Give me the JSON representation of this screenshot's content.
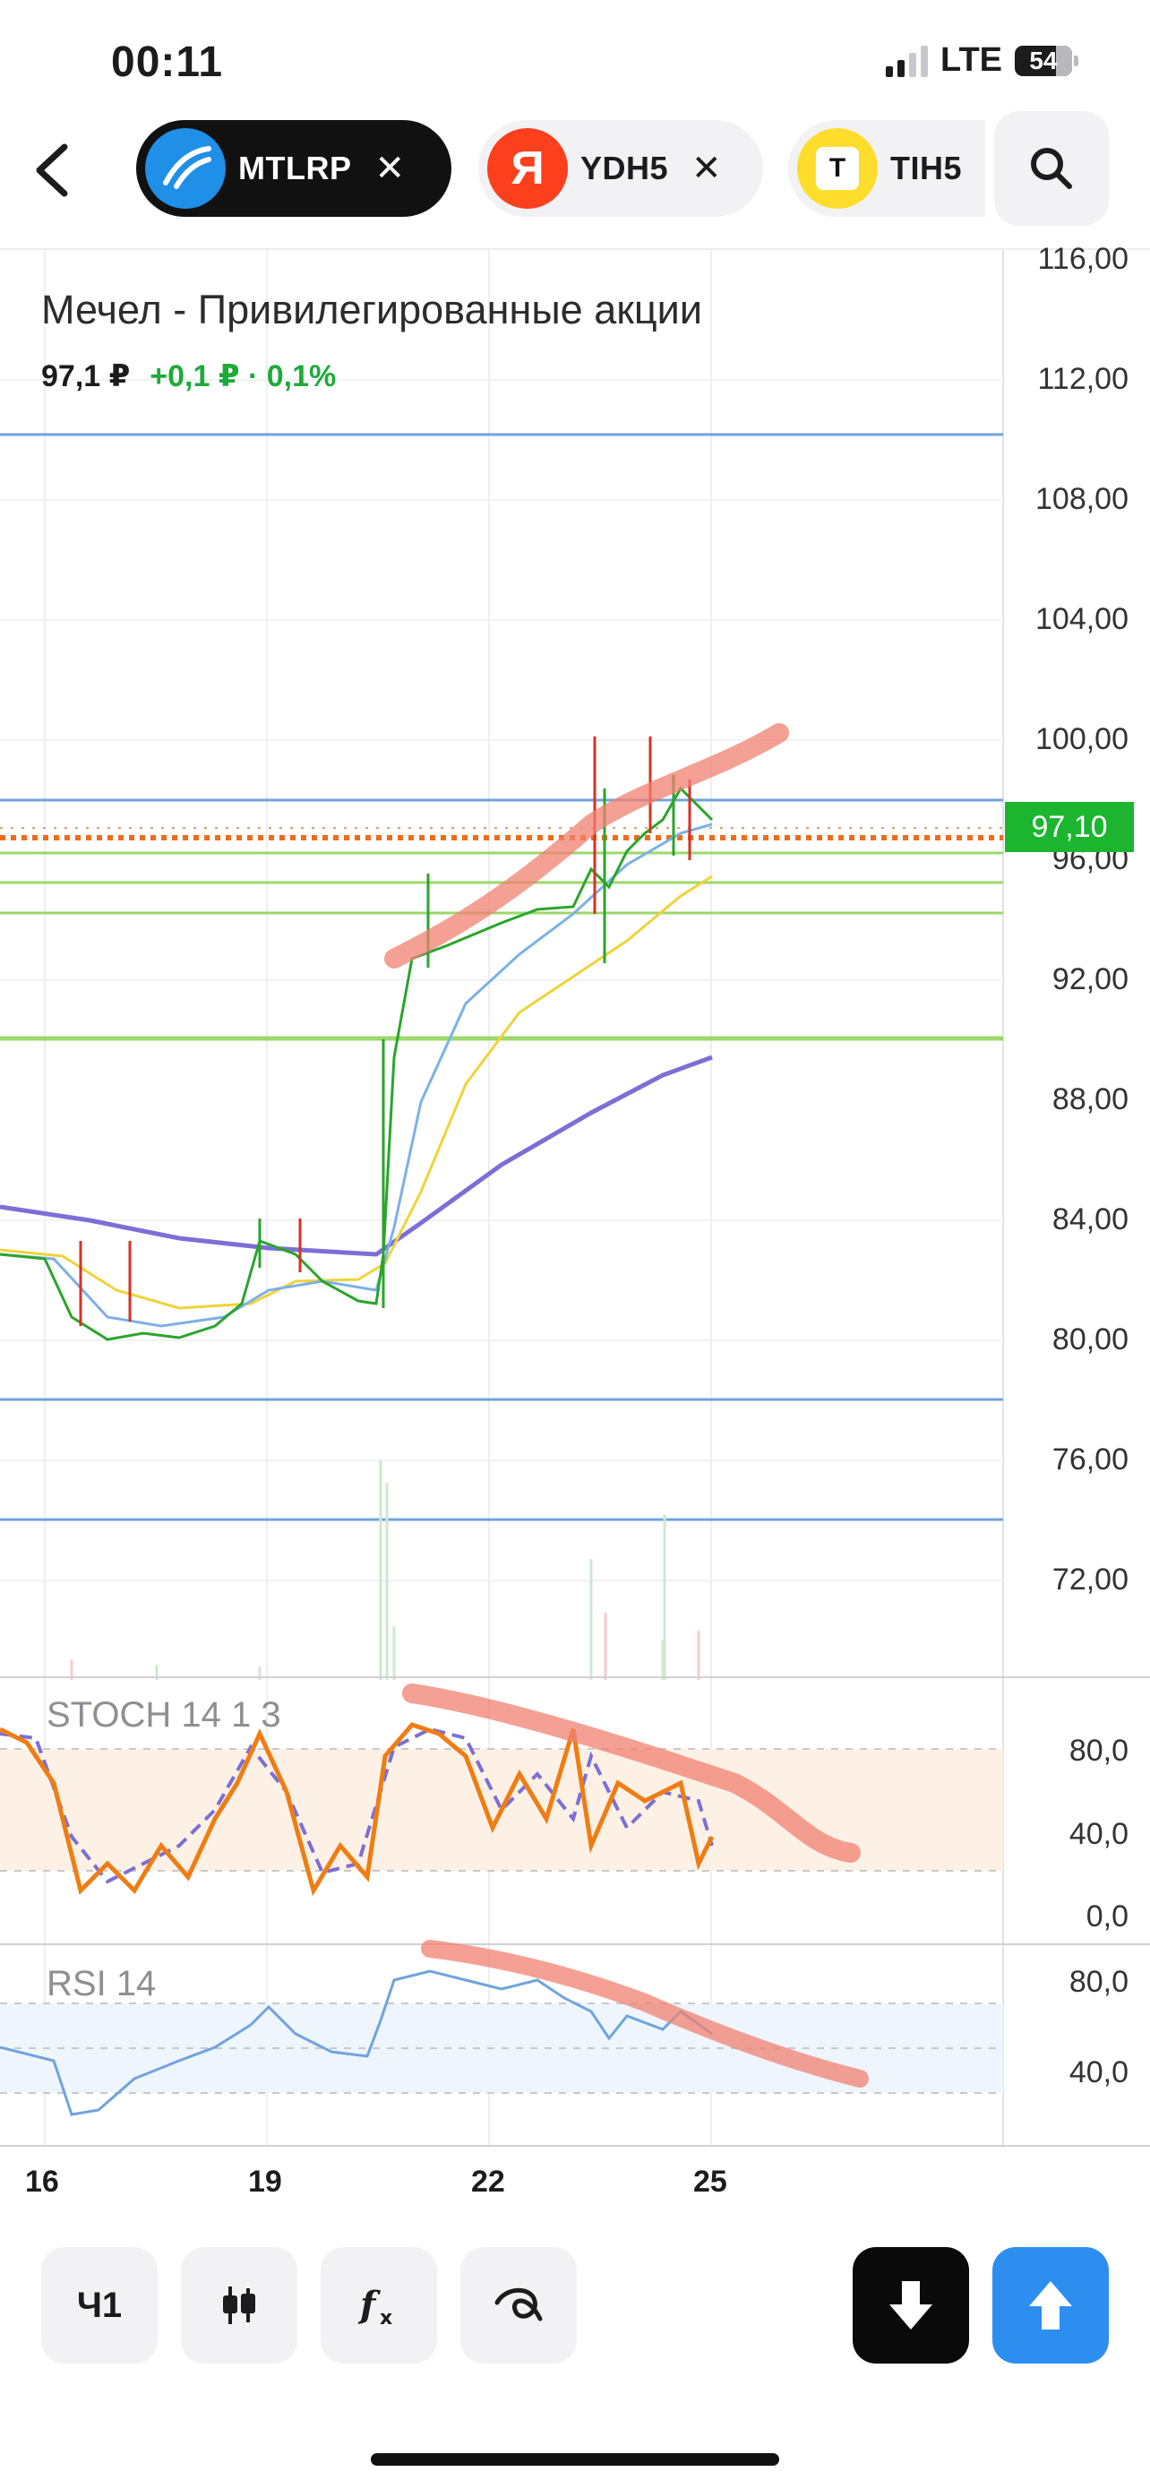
{
  "status_bar": {
    "time": "00:11",
    "network": "LTE",
    "battery": "54"
  },
  "tabs": [
    {
      "ticker": "MTLRP",
      "icon": "mechel-logo",
      "active": true
    },
    {
      "ticker": "YDH5",
      "icon": "yandex-logo",
      "logo_text": "Я",
      "active": false
    },
    {
      "ticker": "TIH5",
      "icon": "tinkoff-logo",
      "logo_text": "T",
      "active": false
    }
  ],
  "instrument": {
    "name": "Мечел - Привилегированные акции",
    "price": "97,1 ₽",
    "change": "+0,1 ₽ · 0,1%"
  },
  "chart": {
    "price_axis": [
      "116,00",
      "112,00",
      "108,00",
      "104,00",
      "100,00",
      "96,00",
      "92,00",
      "88,00",
      "84,00",
      "80,00",
      "76,00",
      "72,00"
    ],
    "last_price_tag": "97,10",
    "stoch_label": "STOCH 14 1 3",
    "stoch_axis": [
      "80,0",
      "40,0",
      "0,0"
    ],
    "rsi_label": "RSI 14",
    "rsi_axis": [
      "80,0",
      "40,0"
    ],
    "dates": [
      "16",
      "19",
      "22",
      "25"
    ]
  },
  "chart_data": {
    "type": "candlestick",
    "title": "Мечел - Привилегированные акции",
    "price_axis_range": [
      70,
      117
    ],
    "last_price": 97.1,
    "series": [
      {
        "kind": "close",
        "x": [
          "16",
          "17",
          "18",
          "19",
          "20",
          "20.5",
          "21",
          "22",
          "23",
          "24",
          "24.5",
          "25"
        ],
        "values": [
          83,
          80.5,
          80.5,
          83.5,
          81,
          92.5,
          93.5,
          95,
          97,
          98,
          98.5,
          97.1
        ]
      },
      {
        "kind": "moving_average_blue",
        "values": [
          82.5,
          81,
          80.5,
          82,
          82,
          85,
          91,
          94,
          95.5,
          96.5,
          97,
          97
        ]
      },
      {
        "kind": "moving_average_yellow",
        "values": [
          82.8,
          81.5,
          81,
          82,
          82.5,
          83,
          87,
          91,
          92.5,
          94,
          95,
          95.5
        ]
      },
      {
        "kind": "moving_average_purple",
        "values": [
          84.5,
          83.8,
          83,
          82.8,
          82.7,
          82.7,
          84.5,
          86.5,
          88,
          89,
          89.5,
          89.5
        ]
      }
    ],
    "horizontal_levels": [
      110,
      98,
      96.8,
      96.3,
      95.4,
      94.3,
      90,
      78,
      74
    ],
    "indicators": {
      "stoch": {
        "params": "14 1 3",
        "range": [
          0,
          100
        ],
        "band": [
          20,
          80
        ]
      },
      "rsi": {
        "params": "14",
        "range": [
          20,
          100
        ],
        "band": [
          30,
          70
        ]
      }
    },
    "colors": {
      "up": "#2aa52a",
      "down": "#d93025",
      "level": "#6fa3de",
      "green_level": "#9cd86a",
      "price_line": "#ef6c1a",
      "trend_marker": "#f08070"
    }
  }
}
